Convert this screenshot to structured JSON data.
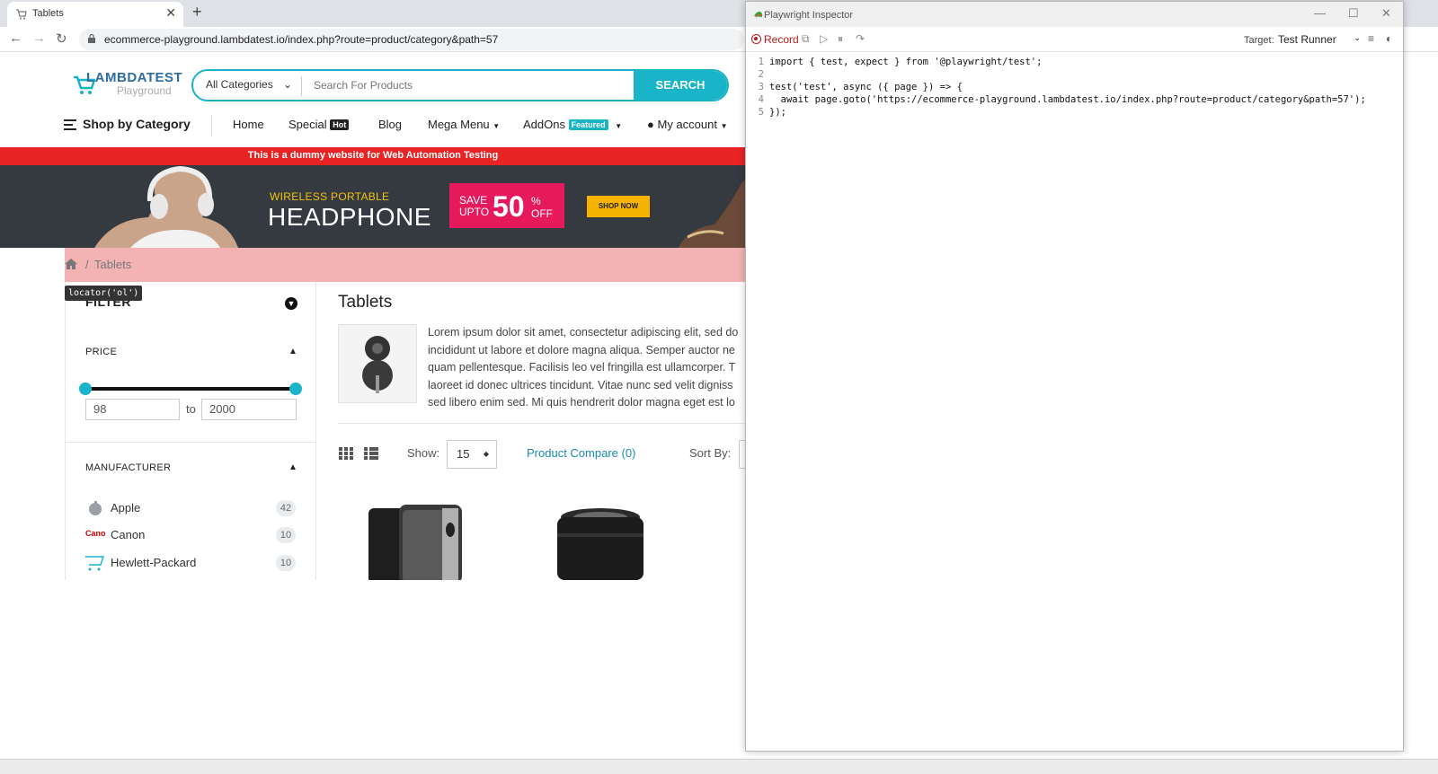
{
  "browser": {
    "tab_title": "Tablets",
    "url": "ecommerce-playground.lambdatest.io/index.php?route=product/category&path=57",
    "new_tab": "+",
    "close_tab": "✕"
  },
  "site": {
    "logo_main": "LAMBDATEST",
    "logo_sub": "Playground",
    "category_select": "All Categories",
    "search_placeholder": "Search For Products",
    "search_button": "SEARCH",
    "nav": {
      "shop_by_category": "Shop by Category",
      "home": "Home",
      "special": "Special",
      "special_badge": "Hot",
      "blog": "Blog",
      "mega_menu": "Mega Menu",
      "addons": "AddOns",
      "addons_badge": "Featured",
      "my_account": "My account"
    },
    "notice": "This is a dummy website for Web Automation Testing",
    "banner": {
      "kicker": "WIRELESS PORTABLE",
      "headline": "HEADPHONE",
      "save_line1": "SAVE",
      "save_line2": "UPTO",
      "save_value": "50",
      "save_pct": "%",
      "save_off": "OFF",
      "cta": "SHOP NOW"
    },
    "breadcrumb": {
      "separator": "/",
      "current": "Tablets"
    },
    "tooltip": "locator('ol')",
    "filter": {
      "title": "FILTER",
      "price_title": "PRICE",
      "price_min": "98",
      "price_max": "2000",
      "to_label": "to",
      "manufacturer_title": "MANUFACTURER",
      "manufacturers": [
        {
          "name": "Apple",
          "count": "42"
        },
        {
          "name": "Canon",
          "count": "10",
          "icon_text": "Cano"
        },
        {
          "name": "Hewlett-Packard",
          "count": "10"
        }
      ]
    },
    "category": {
      "title": "Tablets",
      "description_lines": [
        "Lorem ipsum dolor sit amet, consectetur adipiscing elit, sed do",
        "incididunt ut labore et dolore magna aliqua. Semper auctor ne",
        "quam pellentesque. Facilisis leo vel fringilla est ullamcorper. T",
        "laoreet id donec ultrices tincidunt. Vitae nunc sed velit digniss",
        "sed libero enim sed. Mi quis hendrerit dolor magna eget est lo"
      ],
      "show_label": "Show:",
      "show_value": "15",
      "compare_link": "Product Compare (0)",
      "sort_label": "Sort By:"
    }
  },
  "inspector": {
    "window_title": "Playwright Inspector",
    "record_label": "Record",
    "target_label": "Target:",
    "target_value": "Test Runner",
    "code_lines": [
      {
        "n": "1",
        "text": "import { test, expect } from '@playwright/test';"
      },
      {
        "n": "2",
        "text": ""
      },
      {
        "n": "3",
        "text": "test('test', async ({ page }) => {"
      },
      {
        "n": "4",
        "text": "  await page.goto('https://ecommerce-playground.lambdatest.io/index.php?route=product/category&path=57');"
      },
      {
        "n": "5",
        "text": "});"
      }
    ]
  },
  "colors": {
    "accent": "#1ab4c8",
    "notice_red": "#e82323",
    "breadcrumb_bg": "#f3b3b5",
    "record_red": "#c01a1a"
  }
}
